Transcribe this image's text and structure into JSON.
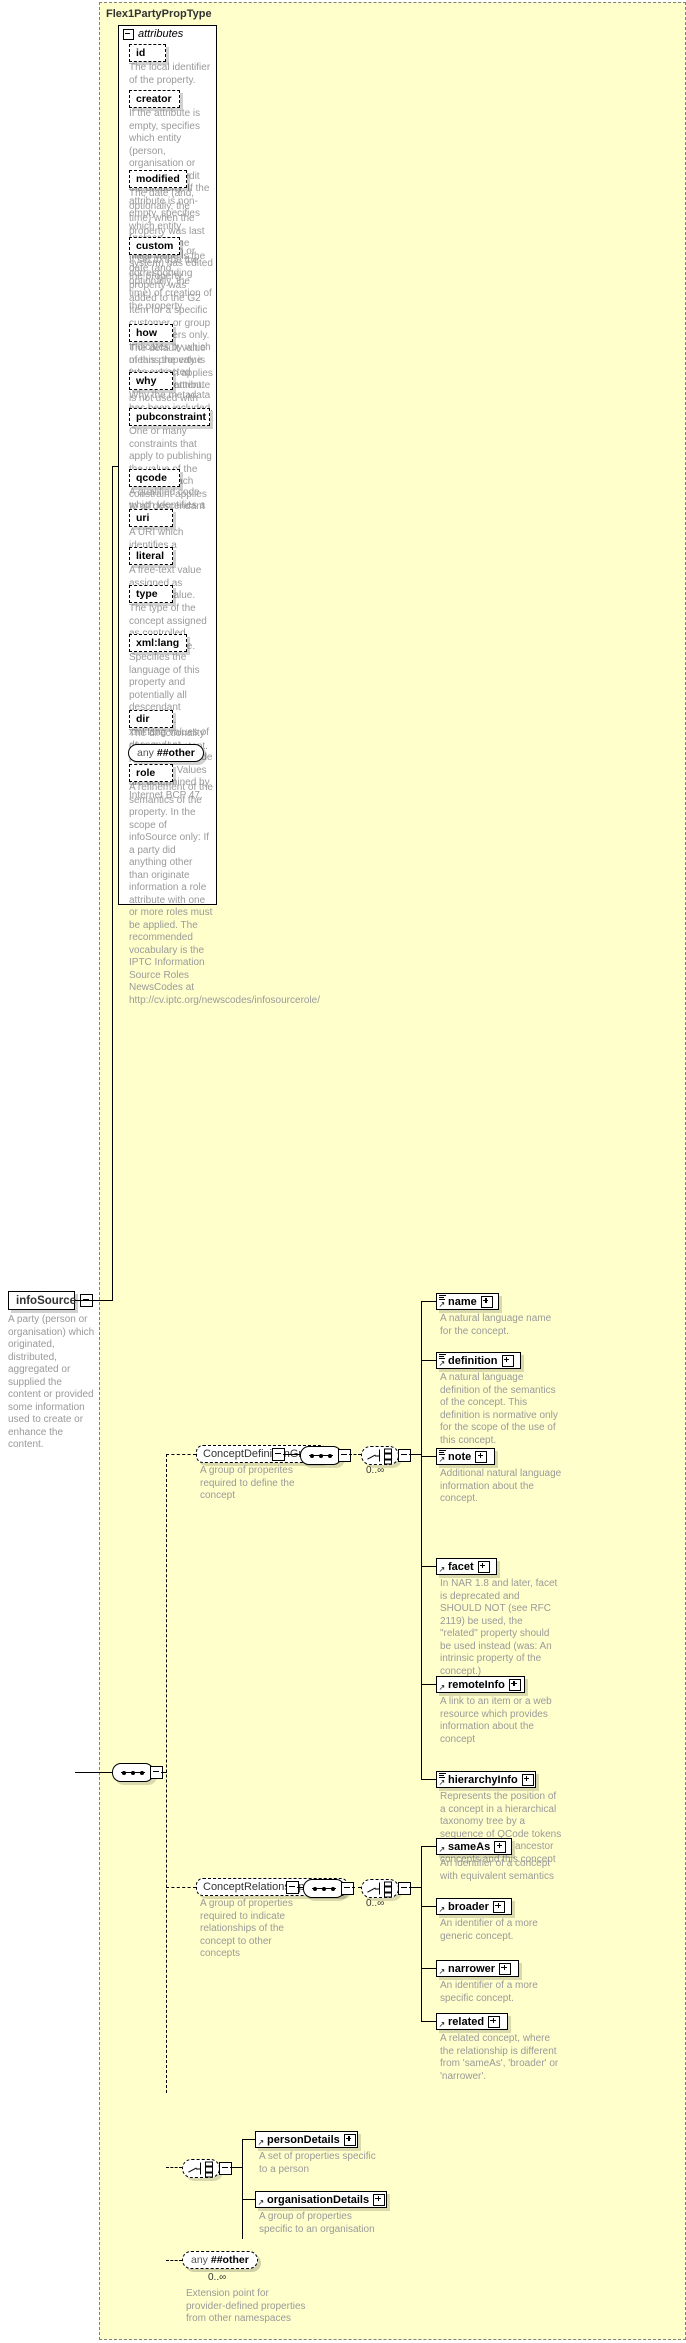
{
  "diagram": {
    "type_name": "Flex1PartyPropType",
    "attributes_label": "attributes",
    "root_element": {
      "name": "infoSource",
      "desc": "A party (person or organisation) which originated, distributed, aggregated or supplied the content or provided some information used to create or enhance the content."
    },
    "attributes": [
      {
        "name": "id",
        "desc": "The local identifier of the property."
      },
      {
        "name": "creator",
        "desc": "If the attribute is empty, specifies which entity (person, organisation or system) will edit the property. If the attribute is non-empty, specifies which entity (person, organisation or system) has edited the property."
      },
      {
        "name": "modified",
        "desc": "The date (and, optionally, the time) when the property was last modified. The initial value is the date (and, optionally, the time) of creation of the property."
      },
      {
        "name": "custom",
        "desc": "If set to true the corresponding property was added to the G2 Item for a specific customer or group of customers only. The default value of this property is false which applies when this attribute is not used with the property."
      },
      {
        "name": "how",
        "desc": "Indicates by which means the value was extracted from the content."
      },
      {
        "name": "why",
        "desc": "Why the metadata has been included."
      },
      {
        "name": "pubconstraint",
        "desc": "One or many constraints that apply to publishing the value of the property. Each constraint applies to all descendant elements."
      },
      {
        "name": "qcode",
        "desc": "A qualified code which identifies a concept."
      },
      {
        "name": "uri",
        "desc": "A URI which identifies a concept."
      },
      {
        "name": "literal",
        "desc": "A free-text value assigned as property value."
      },
      {
        "name": "type",
        "desc": "The type of the concept assigned as controlled property value."
      },
      {
        "name": "xml:lang",
        "desc": "Specifies the language of this property and potentially all descendant properties. xml:lang values of descendant properties override this value. Values are determined by Internet BCP 47."
      },
      {
        "name": "dir",
        "desc": "The directionality of textual content."
      }
    ],
    "attribute_any": {
      "any_label": "any",
      "namespace": "##other"
    },
    "attribute_role": {
      "name": "role",
      "desc": "A refinement of the semantics of the property. In the scope of infoSource only: If a party did anything other than originate information a role attribute with one or more roles must be applied. The recommended vocabulary is the IPTC Information Source Roles NewsCodes at http://cv.iptc.org/newscodes/infosourcerole/"
    },
    "groups": [
      {
        "name": "ConceptDefinitionGroup",
        "desc": "A group of properites required to define the concept",
        "cardinality": "0..∞",
        "elements": [
          {
            "name": "name",
            "desc": "A natural language name for the concept.",
            "icon": "text-lines-icon"
          },
          {
            "name": "definition",
            "desc": "A natural language definition of the semantics of the concept. This definition is normative only for the scope of the use of this concept.",
            "icon": "text-lines-icon"
          },
          {
            "name": "note",
            "desc": "Additional natural language information about the concept.",
            "icon": "text-lines-icon"
          },
          {
            "name": "facet",
            "desc": "In NAR 1.8 and later, facet is deprecated and SHOULD NOT (see RFC 2119) be used, the \"related\" property should be used instead (was: An intrinsic property of the concept.)",
            "icon": "none"
          },
          {
            "name": "remoteInfo",
            "desc": "A link to an item or a web resource which provides information about the concept",
            "icon": "none"
          },
          {
            "name": "hierarchyInfo",
            "desc": "Represents the position of a concept in a hierarchical taxonomy tree by a sequence of QCode tokens representing the ancestor concepts and this concept",
            "icon": "text-lines-icon"
          }
        ]
      },
      {
        "name": "ConceptRelationshipsGroup",
        "desc": "A group of properties required to indicate relationships of the concept to other concepts",
        "cardinality": "0..∞",
        "elements": [
          {
            "name": "sameAs",
            "desc": "An identifier of a concept with equivalent semantics",
            "icon": "none"
          },
          {
            "name": "broader",
            "desc": "An identifier of a more generic concept.",
            "icon": "none"
          },
          {
            "name": "narrower",
            "desc": "An identifier of a more specific concept.",
            "icon": "none"
          },
          {
            "name": "related",
            "desc": "A related concept, where the relationship is different from 'sameAs', 'broader' or 'narrower'.",
            "icon": "none"
          }
        ]
      }
    ],
    "details_choice": {
      "elements": [
        {
          "name": "personDetails",
          "desc": "A set of properties specific to a person"
        },
        {
          "name": "organisationDetails",
          "desc": "A group of properties specific to an organisation"
        }
      ]
    },
    "element_any": {
      "any_label": "any",
      "namespace": "##other",
      "cardinality": "0..∞",
      "desc": "Extension point for provider-defined properties from other namespaces"
    },
    "colors": {
      "container_bg": "#ffffcc",
      "panel_bg": "#ffffff",
      "desc_text": "#9a9a9a",
      "line": "#000000"
    }
  }
}
